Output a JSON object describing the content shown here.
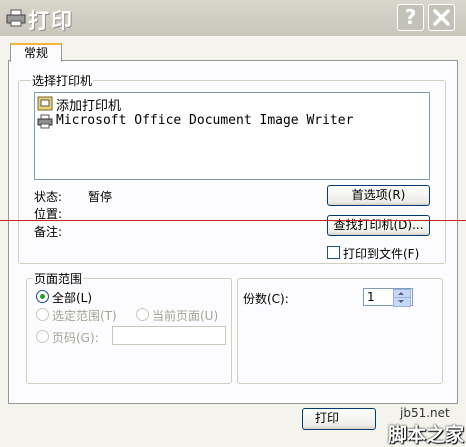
{
  "window": {
    "title": "打印",
    "help_label": "?",
    "close_label": "✕"
  },
  "tabs": [
    {
      "label": "常规",
      "active": true
    }
  ],
  "select_printer": {
    "legend": "选择打印机",
    "printers": [
      {
        "name": "添加打印机",
        "icon": "add-printer-icon"
      },
      {
        "name": "Microsoft Office Document Image Writer",
        "icon": "printer-icon"
      }
    ],
    "status_label": "状态:",
    "status_value": "暂停",
    "location_label": "位置:",
    "location_value": "",
    "comment_label": "备注:",
    "comment_value": "",
    "preferences_button": "首选项(R)",
    "find_printer_button": "查找打印机(D)...",
    "print_to_file_label": "打印到文件(F)",
    "print_to_file_checked": false
  },
  "page_range": {
    "legend": "页面范围",
    "all_label": "全部(L)",
    "selection_label": "选定范围(T)",
    "current_page_label": "当前页面(U)",
    "pages_label": "页码(G):",
    "pages_value": "",
    "selected": "all"
  },
  "copies": {
    "label": "份数(C):",
    "value": "1"
  },
  "footer": {
    "print_button": "打印"
  },
  "watermark": {
    "site": "jb51.net",
    "name": "脚本之家"
  },
  "colors": {
    "accent_tab": "#f7b43a",
    "radio_dot": "#21a121",
    "red_line": "#cc2222"
  }
}
